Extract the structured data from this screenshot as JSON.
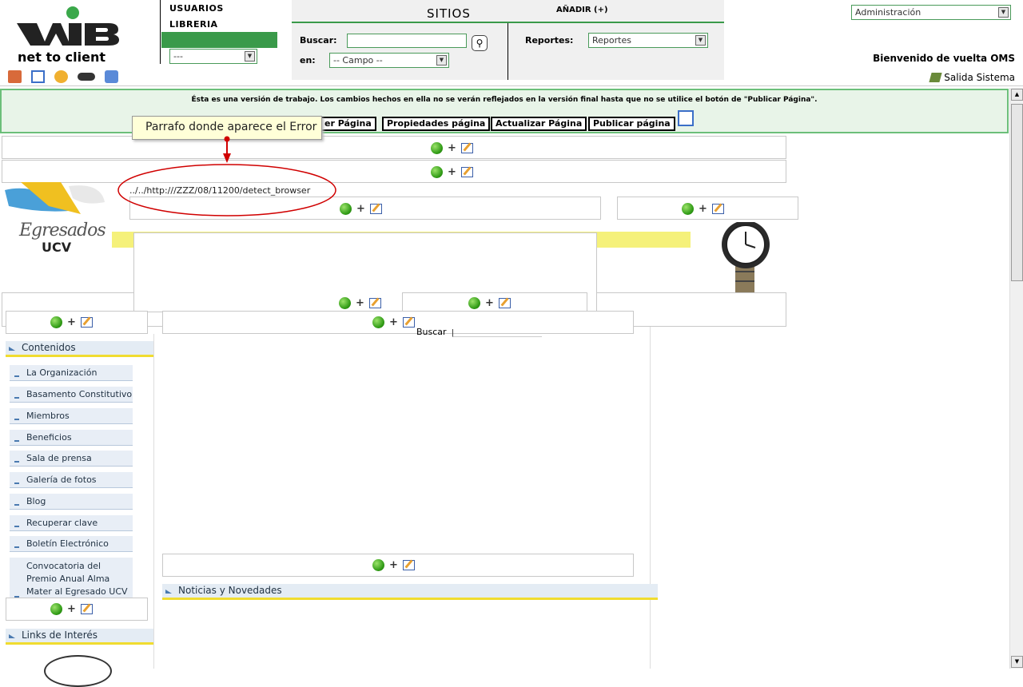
{
  "header": {
    "logo_text": "net to client",
    "menu": [
      "USUARIOS",
      "LIBRERIA"
    ],
    "left_select": "---",
    "sitios": "SITIOS",
    "anadir": "AÑADIR (+)",
    "buscar_label": "Buscar:",
    "buscar_value": "",
    "en_label": "en:",
    "campo_select": "-- Campo --",
    "reportes_label": "Reportes:",
    "reportes_select": "Reportes",
    "admin_select": "Administración",
    "welcome": "Bienvenido de vuelta OMS",
    "logout": "Salida Sistema"
  },
  "banner": {
    "message": "Ésta es una versión de trabajo. Los cambios hechos en ella no se verán reflejados en la versión final hasta que no se utilice el botón de \"Publicar Página\".",
    "buttons": [
      "er Página",
      "Propiedades página",
      "Actualizar Página",
      "Publicar página"
    ]
  },
  "annotation": {
    "tooltip": "Parrafo donde aparece el Error",
    "error_path": "../../http:///ZZZ/08/11200/detect_browser"
  },
  "logo_egresados": {
    "line1": "Egresados",
    "line2": "UCV"
  },
  "partial_label": "Buscar",
  "sidebar": {
    "section_title": "Contenidos",
    "items": [
      "La Organización",
      "Basamento Constitutivo",
      "Miembros",
      "Beneficios",
      "Sala de prensa",
      "Galería de fotos",
      "Blog",
      "Recuperar clave",
      "Boletín Electrónico",
      "Convocatoria del Premio Anual Alma Mater al Egresado UCV"
    ],
    "links_title": "Links de Interés"
  },
  "news_title": "Noticias y Novedades",
  "colors": {
    "accent_green": "#3a9a4a",
    "banner_bg": "#e8f4e8",
    "yellow_bar": "#f5f17a",
    "annotation_red": "#d00000"
  }
}
